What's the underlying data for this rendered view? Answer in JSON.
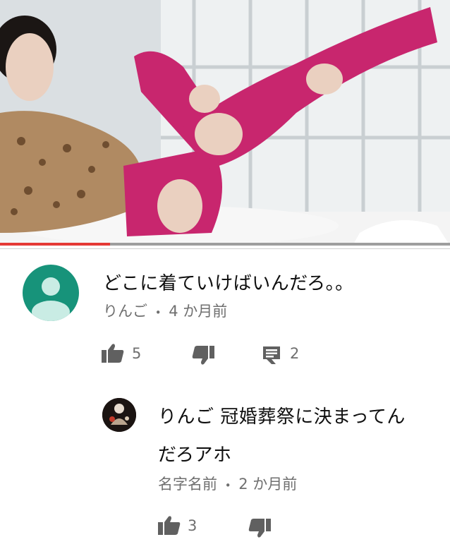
{
  "video": {
    "progress_fraction": 0.245
  },
  "comment": {
    "text": "どこに着ていけばいんだろ。。",
    "author": "りんご",
    "time": "4 か月前",
    "meta_separator": "•",
    "like_count": "5",
    "reply_count": "2"
  },
  "reply": {
    "text_line1": "りんご 冠婚葬祭に決まってん",
    "text_line2": "だろアホ",
    "author": "名字名前",
    "time": "2 か月前",
    "meta_separator": "•",
    "like_count": "3"
  },
  "icons": {
    "like": "thumbs-up-icon",
    "dislike": "thumbs-down-icon",
    "reply": "comment-icon",
    "avatar": "default-user-avatar"
  },
  "colors": {
    "progress": "#e53935",
    "avatar_bg": "#17937a",
    "meta_text": "#6f6f6f"
  }
}
